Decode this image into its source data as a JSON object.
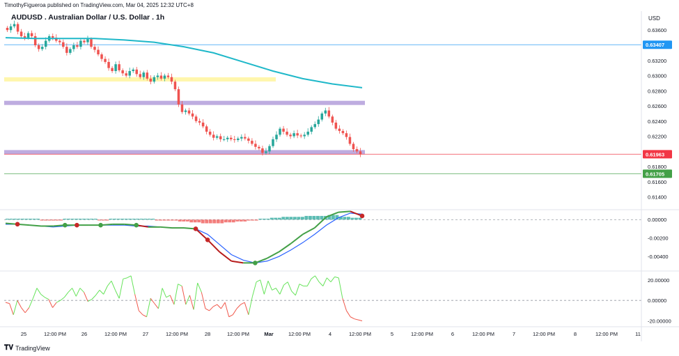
{
  "header": {
    "publisher": "TimothyFigueroa published on TradingView.com, Mar 04, 2025 12:32 UTC+8"
  },
  "title": "AUDUSD . Australian Dollar / U.S. Dollar . 1h",
  "currency": "USD",
  "footer": {
    "brand": "TradingView",
    "logo_icon": "tradingview-logo-icon"
  },
  "colors": {
    "up": "#26a69a",
    "down": "#ef5350",
    "ma": "#1fb8c9",
    "hline_blue": "#2196f3",
    "hline_red": "#f23645",
    "hline_green": "#43a047",
    "band_yellow": "#fff59d",
    "band_purple": "#b39ddb"
  },
  "chart_data": [
    {
      "type": "candlestick",
      "name": "price",
      "ylim": [
        0.6124,
        0.6374
      ],
      "yticks": [
        0.614,
        0.616,
        0.618,
        0.62,
        0.622,
        0.624,
        0.626,
        0.628,
        0.63,
        0.632,
        0.634,
        0.636
      ],
      "ytick_labels": [
        "0.61400",
        "0.61600",
        "0.61800",
        "",
        "0.62200",
        "0.62400",
        "0.62600",
        "0.62800",
        "0.63000",
        "0.63200",
        "",
        "0.63600"
      ],
      "price_labels": [
        {
          "value": 0.63407,
          "label": "0.63407",
          "color": "#2196f3"
        },
        {
          "value": 0.61963,
          "label": "0.61963",
          "color": "#f23645"
        },
        {
          "value": 0.61705,
          "label": "0.61705",
          "color": "#43a047"
        }
      ],
      "close_path": [
        0.636,
        0.6365,
        0.6368,
        0.6358,
        0.6352,
        0.635,
        0.6356,
        0.6352,
        0.634,
        0.6335,
        0.6338,
        0.6346,
        0.6352,
        0.635,
        0.6346,
        0.6344,
        0.6338,
        0.633,
        0.6335,
        0.634,
        0.6338,
        0.6346,
        0.6344,
        0.6348,
        0.6338,
        0.6334,
        0.6328,
        0.6322,
        0.6318,
        0.631,
        0.6306,
        0.6315,
        0.6307,
        0.6303,
        0.63,
        0.6306,
        0.6308,
        0.6302,
        0.6298,
        0.6304,
        0.6296,
        0.6292,
        0.6298,
        0.63,
        0.6296,
        0.63,
        0.6298,
        0.6292,
        0.6282,
        0.6262,
        0.6252,
        0.6254,
        0.625,
        0.6246,
        0.624,
        0.6238,
        0.6233,
        0.6226,
        0.6222,
        0.6218,
        0.622,
        0.6216,
        0.6216,
        0.6218,
        0.6216,
        0.6215,
        0.6217,
        0.6219,
        0.6217,
        0.6214,
        0.621,
        0.6206,
        0.6204,
        0.6198,
        0.62,
        0.6207,
        0.6216,
        0.6222,
        0.623,
        0.6226,
        0.6222,
        0.622,
        0.6224,
        0.6221,
        0.622,
        0.6222,
        0.6226,
        0.6232,
        0.6236,
        0.6242,
        0.625,
        0.6254,
        0.6246,
        0.6238,
        0.623,
        0.6227,
        0.6224,
        0.6219,
        0.621,
        0.6203,
        0.62,
        0.6196
      ],
      "ma_path": [
        0.635,
        0.6349,
        0.6349,
        0.6349,
        0.6347,
        0.6344,
        0.6338,
        0.633,
        0.6318,
        0.6306,
        0.6296,
        0.6289,
        0.6284
      ],
      "hlines": [
        {
          "value": 0.63407,
          "color": "#2196f3"
        },
        {
          "value": 0.61963,
          "color": "#f23645"
        },
        {
          "value": 0.61705,
          "color": "#43a047"
        }
      ],
      "bands": [
        {
          "value": 0.6295,
          "color": "#fff59d"
        },
        {
          "value": 0.6264,
          "color": "#b39ddb"
        },
        {
          "value": 0.6199,
          "color": "#b39ddb"
        }
      ]
    },
    {
      "type": "macd",
      "ylim": [
        -0.0055,
        0.001
      ],
      "yticks": [
        0.0,
        -0.002,
        -0.004
      ],
      "ytick_labels": [
        "0.00000",
        "-0.00200",
        "-0.00400"
      ],
      "macd_path": [
        -0.0004,
        -0.0005,
        -0.0006,
        -0.0007,
        -0.0007,
        -0.0006,
        -0.0006,
        -0.0006,
        -0.0006,
        -0.0005,
        -0.0005,
        -0.0006,
        -0.0008,
        -0.0008,
        -0.0009,
        -0.0009,
        -0.001,
        -0.0022,
        -0.0035,
        -0.0045,
        -0.0047,
        -0.0047,
        -0.0042,
        -0.0035,
        -0.0026,
        -0.0016,
        -0.0009,
        0.0003,
        0.0008,
        0.0009,
        0.0004
      ],
      "signal_path": [
        -0.0005,
        -0.0005,
        -0.0006,
        -0.0007,
        -0.0008,
        -0.0007,
        -0.0006,
        -0.0006,
        -0.0006,
        -0.0006,
        -0.0006,
        -0.0007,
        -0.0007,
        -0.0008,
        -0.0009,
        -0.0009,
        -0.001,
        -0.0016,
        -0.0027,
        -0.0038,
        -0.0044,
        -0.0047,
        -0.0045,
        -0.004,
        -0.0033,
        -0.0025,
        -0.0016,
        -0.0006,
        0.0002,
        0.0007,
        0.0006
      ],
      "crosses": [
        {
          "i": 1,
          "color": "#c62828"
        },
        {
          "i": 5,
          "color": "#43a047"
        },
        {
          "i": 6,
          "color": "#c62828"
        },
        {
          "i": 8,
          "color": "#43a047"
        },
        {
          "i": 11,
          "color": "#43a047"
        },
        {
          "i": 16,
          "color": "#c62828"
        },
        {
          "i": 17,
          "color": "#c62828"
        },
        {
          "i": 21,
          "color": "#43a047"
        },
        {
          "i": 30,
          "color": "#c62828"
        }
      ],
      "histogram": [
        0.0001,
        0.0001,
        0.0001,
        -0.0001,
        -0.0001,
        0.0001,
        0.0001,
        0.0001,
        -0.0001,
        0.0001,
        0.0001,
        0.0001,
        0.0001,
        -0.0001,
        -0.0001,
        -0.0002,
        -0.0003,
        -0.0004,
        -0.0004,
        -0.0003,
        -0.0002,
        -0.0001,
        0.0001,
        0.0002,
        0.0003,
        0.0003,
        0.0004,
        0.0004,
        0.0005,
        0.0003,
        0.0002
      ]
    },
    {
      "type": "oscillator",
      "ylim": [
        -25,
        28
      ],
      "yticks": [
        20,
        0,
        -20
      ],
      "ytick_labels": [
        "20.00000",
        "0.00000",
        "-20.00000"
      ],
      "values": [
        -2,
        -3,
        -14,
        0,
        -7,
        -12,
        -7,
        2,
        12,
        6,
        3,
        1,
        -7,
        -2,
        0,
        3,
        8,
        12,
        4,
        12,
        8,
        -1,
        1,
        5,
        10,
        6,
        14,
        19,
        10,
        2,
        21,
        22,
        24,
        6,
        -10,
        -14,
        -16,
        2,
        -3,
        -8,
        12,
        3,
        5,
        -4,
        16,
        14,
        -4,
        5,
        -9,
        17,
        8,
        -8,
        -10,
        -6,
        -4,
        -8,
        -2,
        -16,
        -14,
        -8,
        -4,
        -2,
        -14,
        4,
        18,
        20,
        6,
        19,
        10,
        12,
        6,
        15,
        18,
        9,
        5,
        16,
        14,
        14,
        21,
        24,
        18,
        14,
        22,
        18,
        23,
        22,
        2,
        -10,
        -16,
        -18,
        -19,
        -20
      ]
    }
  ],
  "xaxis": [
    "25",
    "12:00 PM",
    "26",
    "12:00 PM",
    "27",
    "12:00 PM",
    "28",
    "12:00 PM",
    "Mar",
    "12:00 PM",
    "4",
    "12:00 PM",
    "5",
    "12:00 PM",
    "6",
    "12:00 PM",
    "7",
    "12:00 PM",
    "8",
    "12:00 PM",
    "11"
  ]
}
